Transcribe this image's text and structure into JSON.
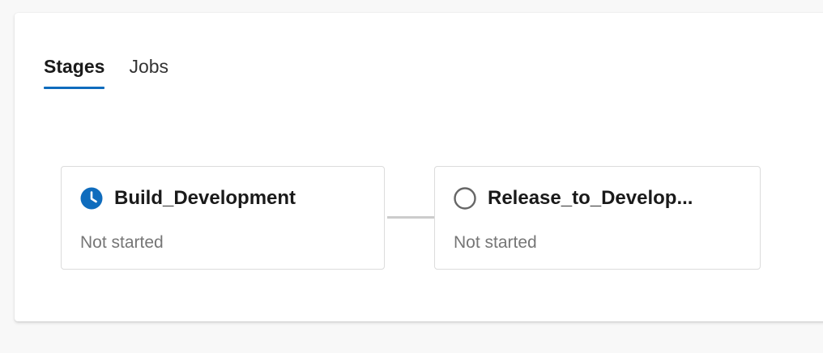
{
  "tabs": [
    {
      "label": "Stages",
      "selected": true
    },
    {
      "label": "Jobs",
      "selected": false
    }
  ],
  "stages": [
    {
      "name": "Build_Development",
      "status": "Not started",
      "icon": "clock-icon",
      "icon_color": "#0f6cbd"
    },
    {
      "name": "Release_to_Develop...",
      "status": "Not started",
      "icon": "circle-outline-icon",
      "icon_color": "#666666"
    }
  ],
  "colors": {
    "accent": "#0f6cbd",
    "connector": "#cccccc"
  }
}
